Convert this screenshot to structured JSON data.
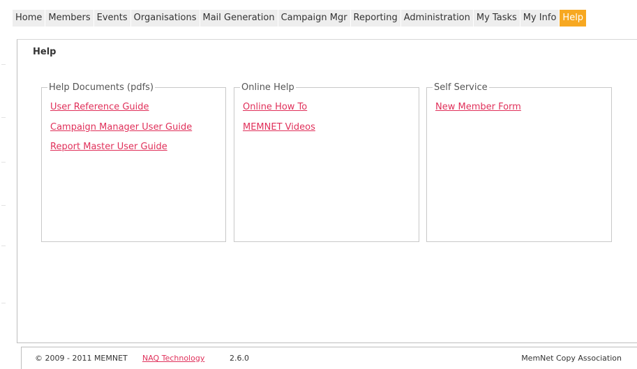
{
  "nav": {
    "items": [
      {
        "label": "Home"
      },
      {
        "label": "Members"
      },
      {
        "label": "Events"
      },
      {
        "label": "Organisations"
      },
      {
        "label": "Mail Generation"
      },
      {
        "label": "Campaign Mgr"
      },
      {
        "label": "Reporting"
      },
      {
        "label": "Administration"
      },
      {
        "label": "My Tasks"
      },
      {
        "label": "My Info"
      },
      {
        "label": "Help"
      }
    ],
    "active": "Help"
  },
  "page": {
    "title": "Help"
  },
  "sections": [
    {
      "title": "Help Documents (pdfs)",
      "links": [
        "User Reference Guide",
        "Campaign Manager User Guide",
        "Report Master User Guide"
      ]
    },
    {
      "title": "Online Help",
      "links": [
        "Online How To",
        "MEMNET Videos"
      ]
    },
    {
      "title": "Self Service",
      "links": [
        "New Member Form"
      ]
    }
  ],
  "footer": {
    "copyright": "© 2009 - 2011 MEMNET",
    "company": "NAQ Technology",
    "version": "2.6.0",
    "association": "MemNet Copy Association"
  },
  "colors": {
    "accent": "#f7a821",
    "link": "#e0305a",
    "tab_bg": "#eeeeee"
  }
}
